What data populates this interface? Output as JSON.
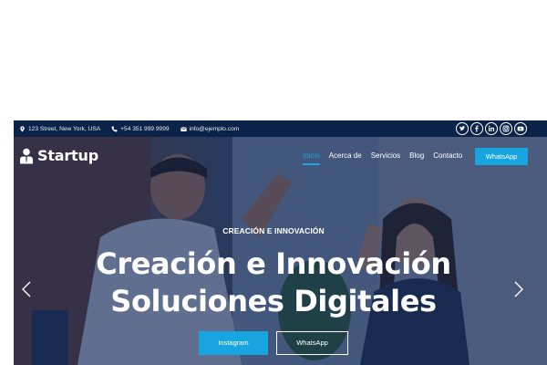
{
  "topbar": {
    "address": "123 Street, New York, USA",
    "phone": "+54 351 999 9999",
    "email": "info@ejemplo.com",
    "socials": [
      "twitter-icon",
      "facebook-icon",
      "linkedin-icon",
      "instagram-icon",
      "youtube-icon"
    ]
  },
  "navbar": {
    "brand": "Startup",
    "menu": [
      "Inicio",
      "Acerca de",
      "Servicios",
      "Blog",
      "Contacto"
    ],
    "active_index": 0,
    "whatsapp_button": "WhatsApp"
  },
  "hero": {
    "eyebrow": "CREACIÓN E INNOVACIÓN",
    "headline_line1": "Creación e Innovación",
    "headline_line2": "Soluciones Digitales",
    "primary_button": "Instagram",
    "secondary_button": "WhatsApp",
    "prev_arrow": "‹",
    "next_arrow": "›"
  },
  "colors": {
    "topbar_bg": "#0b2249",
    "accent": "#18a5df",
    "overlay": "#0a1e4b"
  }
}
